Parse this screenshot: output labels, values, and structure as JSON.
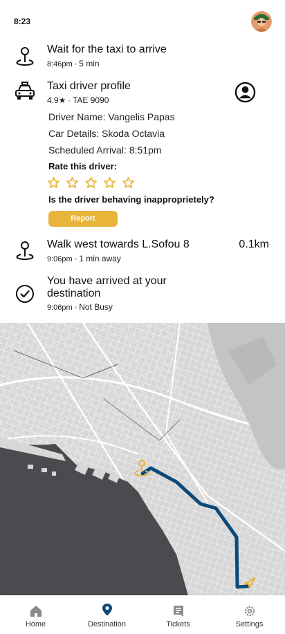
{
  "status_bar": {
    "time": "8:23"
  },
  "steps": [
    {
      "title": "Wait for the taxi to arrive",
      "time": "8:46pm",
      "meta": "5 min"
    },
    {
      "title": "Taxi driver profile",
      "rating": "4.9★",
      "plate": "TAE 9090"
    },
    {
      "title": "Walk west towards L.Sofou 8",
      "time": "9:06pm",
      "meta": "1 min away",
      "distance": "0.1km"
    },
    {
      "title_line1": "You have arrived at your",
      "title_line2": "destination",
      "time": "9:06pm",
      "meta": "Not Busy"
    }
  ],
  "driver": {
    "name_line": "Driver Name: Vangelis Papas",
    "car_line": "Car Details: Skoda Octavia",
    "arrival_line": "Scheduled Arrival: 8:51pm",
    "rate_label": "Rate this driver:",
    "star_count": 5,
    "rating_value": 0,
    "behavior_question": "Is the driver behaving inappropriеtely?",
    "report_label": "Report"
  },
  "nav": {
    "items": [
      {
        "label": "Home",
        "icon": "home-icon"
      },
      {
        "label": "Destination",
        "icon": "location-pin-icon"
      },
      {
        "label": "Tickets",
        "icon": "ticket-icon"
      },
      {
        "label": "Settings",
        "icon": "gear-icon"
      }
    ],
    "active": "Destination"
  },
  "colors": {
    "accent": "#e8b43a",
    "route": "#0b4a7a",
    "nav_active": "#0b4a7a"
  }
}
